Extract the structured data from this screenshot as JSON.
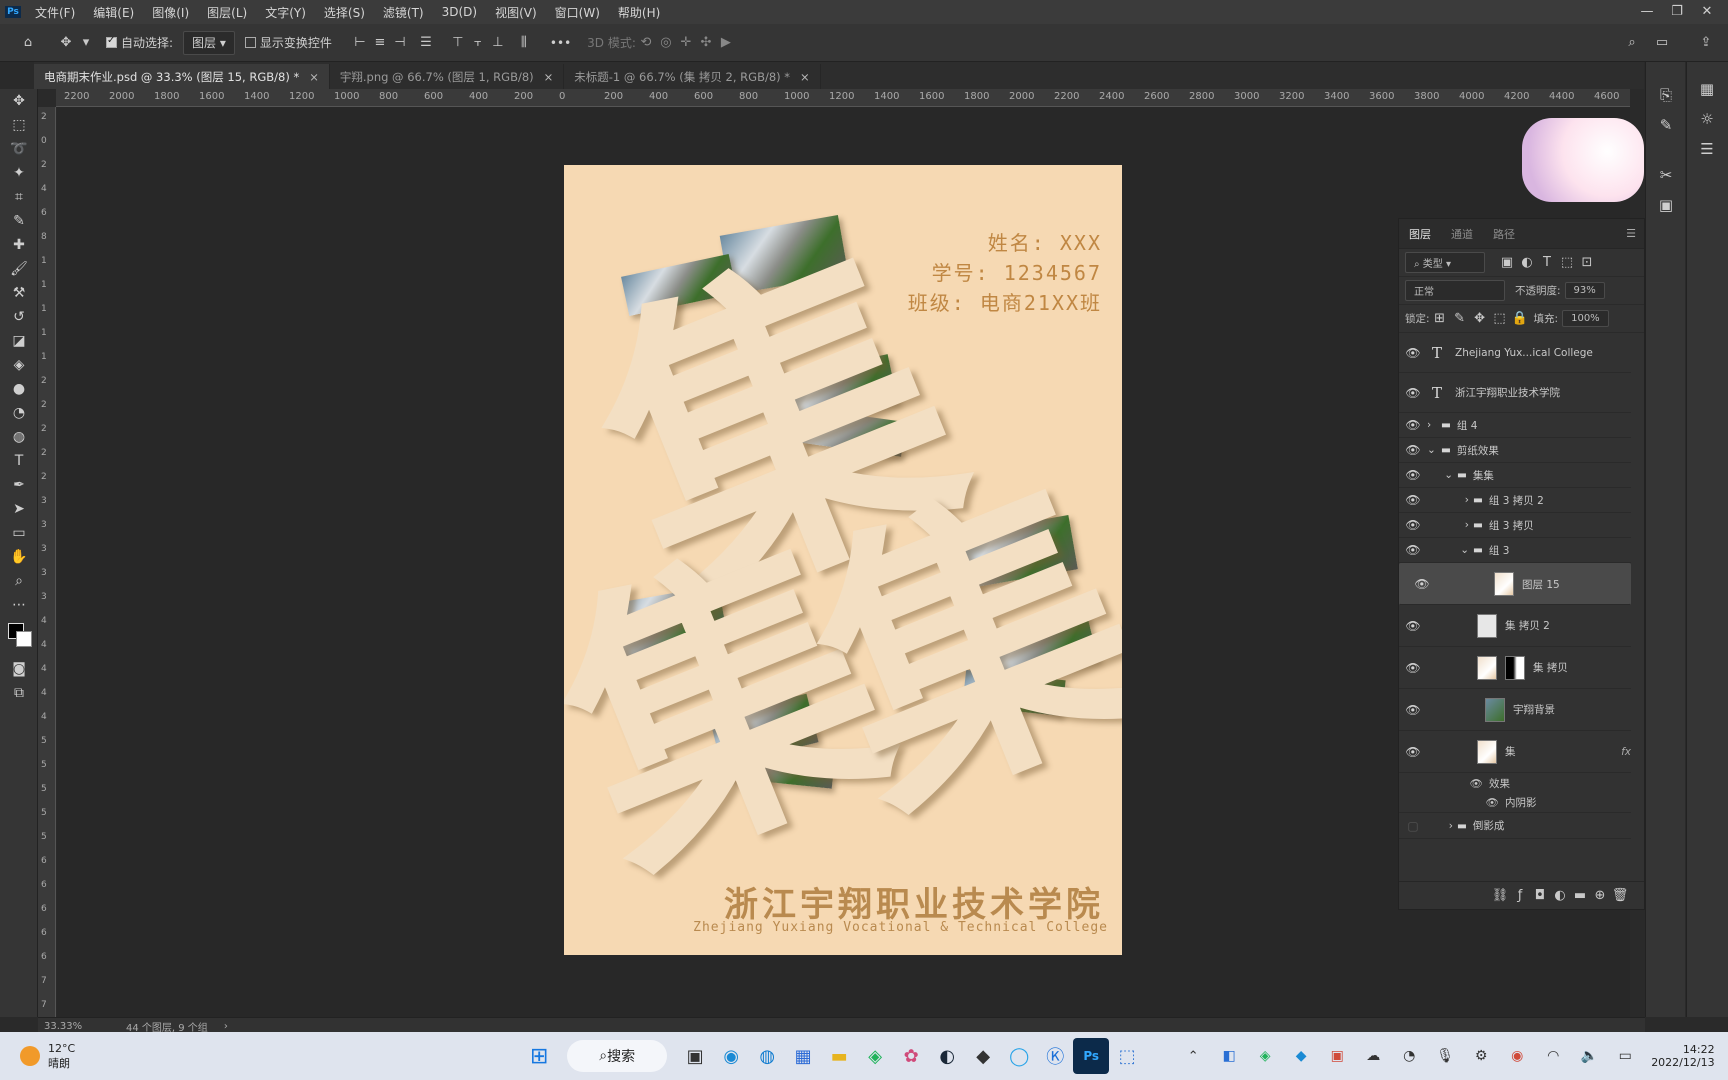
{
  "app": {
    "logo": "Ps"
  },
  "menu": [
    "文件(F)",
    "编辑(E)",
    "图像(I)",
    "图层(L)",
    "文字(Y)",
    "选择(S)",
    "滤镜(T)",
    "3D(D)",
    "视图(V)",
    "窗口(W)",
    "帮助(H)"
  ],
  "window_controls": [
    "—",
    "❐",
    "✕"
  ],
  "options": {
    "auto_select_label": "自动选择:",
    "auto_select_value": "图层",
    "show_transform_label": "显示变换控件",
    "mode_3d_label": "3D 模式:",
    "more": "•••"
  },
  "tabs": [
    {
      "label": "电商期末作业.psd @ 33.3% (图层 15, RGB/8) *",
      "active": true
    },
    {
      "label": "宇翔.png @ 66.7% (图层 1, RGB/8)",
      "active": false
    },
    {
      "label": "未标题-1 @ 66.7% (集 拷贝 2, RGB/8) *",
      "active": false
    }
  ],
  "ruler_h": [
    "2200",
    "2000",
    "1800",
    "1600",
    "1400",
    "1200",
    "1000",
    "800",
    "600",
    "400",
    "200",
    "0",
    "200",
    "400",
    "600",
    "800",
    "1000",
    "1200",
    "1400",
    "1600",
    "1800",
    "2000",
    "2200",
    "2400",
    "2600",
    "2800",
    "3000",
    "3200",
    "3400",
    "3600",
    "3800",
    "4000",
    "4200",
    "4400",
    "4600"
  ],
  "ruler_v": [
    "2",
    "0",
    "2",
    "4",
    "6",
    "8",
    "1",
    "1",
    "1",
    "1",
    "1",
    "2",
    "2",
    "2",
    "2",
    "2",
    "3",
    "3",
    "3",
    "3",
    "3",
    "4",
    "4",
    "4",
    "4",
    "4",
    "5",
    "5",
    "5",
    "5",
    "5",
    "6",
    "6",
    "6",
    "6",
    "6",
    "7",
    "7"
  ],
  "poster": {
    "big_char": "集",
    "name_line": "姓名: XXX",
    "id_line": "学号: 1234567",
    "class_line": "班级: 电商21XX班",
    "college_cn": "浙江宇翔职业技术学院",
    "college_en": "Zhejiang Yuxiang Vocational & Technical College",
    "background_color": "#f6d9b3"
  },
  "layers_panel": {
    "tabs": [
      "图层",
      "通道",
      "路径"
    ],
    "filter_label": "类型",
    "blend_mode": "正常",
    "opacity_label": "不透明度:",
    "opacity_value": "93%",
    "lock_label": "锁定:",
    "fill_label": "填充:",
    "fill_value": "100%",
    "layers": [
      {
        "name": "Zhejiang Yux...ical College",
        "kind": "text"
      },
      {
        "name": "浙江宇翔职业技术学院",
        "kind": "text"
      },
      {
        "name": "组 4",
        "kind": "group"
      },
      {
        "name": "剪纸效果",
        "kind": "group"
      },
      {
        "name": "集集",
        "kind": "group"
      },
      {
        "name": "组 3 拷贝 2",
        "kind": "group"
      },
      {
        "name": "组 3 拷贝",
        "kind": "group"
      },
      {
        "name": "组 3",
        "kind": "group"
      },
      {
        "name": "图层 15",
        "kind": "pixel",
        "selected": true
      },
      {
        "name": "集 拷贝 2",
        "kind": "pixel"
      },
      {
        "name": "集 拷贝",
        "kind": "pixel"
      },
      {
        "name": "宇翔背景",
        "kind": "pixel"
      },
      {
        "name": "集",
        "kind": "pixel",
        "fx": "fx"
      },
      {
        "name": "效果",
        "kind": "effect"
      },
      {
        "name": "内阴影",
        "kind": "effect"
      },
      {
        "name": "倒影成",
        "kind": "group"
      }
    ]
  },
  "status": {
    "zoom": "33.33%",
    "info": "44 个图层, 9 个组"
  },
  "taskbar": {
    "weather_temp": "12°C",
    "weather_desc": "晴朗",
    "search_label": "搜索",
    "time": "14:22",
    "date": "2022/12/13"
  }
}
